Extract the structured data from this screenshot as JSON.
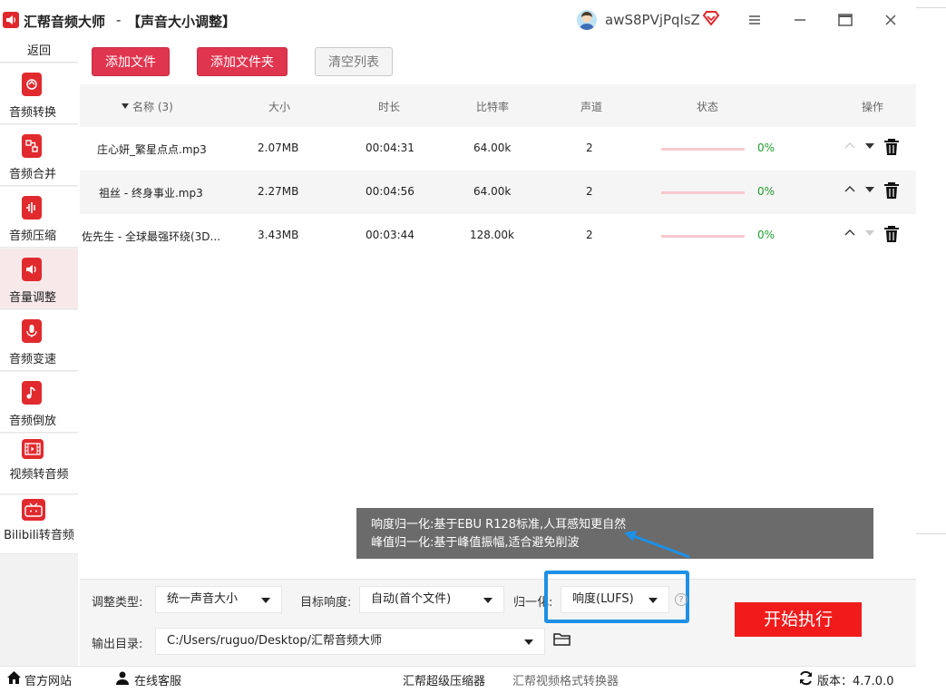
{
  "titlebar": {
    "app_name": "汇帮音频大师",
    "separator": "-",
    "page_title": "【声音大小调整】",
    "username": "awS8PVjPqlsZ"
  },
  "sidebar": {
    "back_label": "返回",
    "items": [
      {
        "label": "音频转换",
        "icon": "refresh-icon"
      },
      {
        "label": "音频合并",
        "icon": "merge-icon"
      },
      {
        "label": "音频压缩",
        "icon": "compress-icon"
      },
      {
        "label": "音量调整",
        "icon": "volume-icon",
        "active": true
      },
      {
        "label": "音频变速",
        "icon": "microphone-icon"
      },
      {
        "label": "音频倒放",
        "icon": "music-note-icon"
      },
      {
        "label": "视频转音频",
        "icon": "film-icon"
      },
      {
        "label": "Bilibili转音频",
        "icon": "tv-icon"
      }
    ]
  },
  "toolbar": {
    "add_file": "添加文件",
    "add_folder": "添加文件夹",
    "clear_list": "清空列表"
  },
  "table": {
    "headers": {
      "name": "名称 (3)",
      "size": "大小",
      "duration": "时长",
      "bitrate": "比特率",
      "channels": "声道",
      "status": "状态",
      "actions": "操作"
    },
    "rows": [
      {
        "name": "庄心妍_繁星点点.mp3",
        "size": "2.07MB",
        "duration": "00:04:31",
        "bitrate": "64.00k",
        "channels": "2",
        "progress": "0%"
      },
      {
        "name": "祖丝 - 终身事业.mp3",
        "size": "2.27MB",
        "duration": "00:04:56",
        "bitrate": "64.00k",
        "channels": "2",
        "progress": "0%"
      },
      {
        "name": "佐先生 - 全球最强环绕(3D...",
        "size": "3.43MB",
        "duration": "00:03:44",
        "bitrate": "128.00k",
        "channels": "2",
        "progress": "0%"
      }
    ]
  },
  "tooltip": {
    "line1": "响度归一化:基于EBU R128标准,人耳感知更自然",
    "line2": "峰值归一化:基于峰值振幅,适合避免削波"
  },
  "settings": {
    "adjust_type_label": "调整类型:",
    "adjust_type_value": "统一声音大小",
    "target_loudness_label": "目标响度:",
    "target_loudness_value": "自动(首个文件)",
    "normalize_label": "归一化:",
    "normalize_value": "响度(LUFS)",
    "help": "?",
    "output_label": "输出目录:",
    "output_path": "C:/Users/ruguo/Desktop/汇帮音频大师",
    "start_button": "开始执行"
  },
  "statusbar": {
    "website": "官方网站",
    "support": "在线客服",
    "link1": "汇帮超级压缩器",
    "link2": "汇帮视频格式转换器",
    "version": "版本：4.7.0.0"
  },
  "colors": {
    "accent_red": "#e0354f",
    "start_red": "#f21b1b",
    "progress_green": "#1f9d2b",
    "highlight_blue": "#1e90e6"
  }
}
